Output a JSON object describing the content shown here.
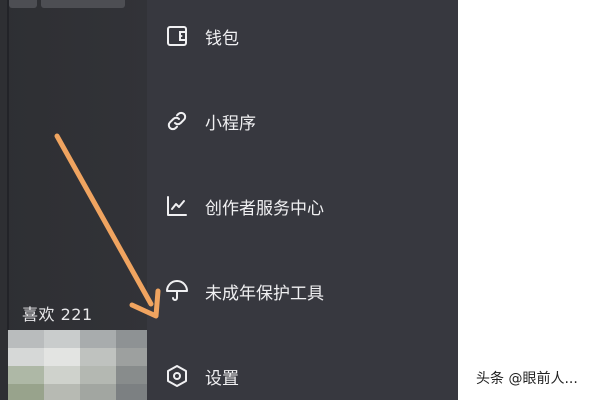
{
  "left_panel": {
    "likes_text": "喜欢 221"
  },
  "menu": {
    "items": [
      {
        "label": "钱包",
        "icon": "wallet-icon"
      },
      {
        "label": "小程序",
        "icon": "link-icon"
      },
      {
        "label": "创作者服务中心",
        "icon": "chart-icon"
      },
      {
        "label": "未成年保护工具",
        "icon": "umbrella-icon"
      },
      {
        "label": "设置",
        "icon": "settings-icon"
      }
    ]
  },
  "watermark": {
    "text": "头条 @眼前人..."
  },
  "colors": {
    "drawer_bg": "#37383f",
    "left_bg": "#2e2f33",
    "arrow": "#f0a460",
    "text": "#f0f0f2"
  }
}
